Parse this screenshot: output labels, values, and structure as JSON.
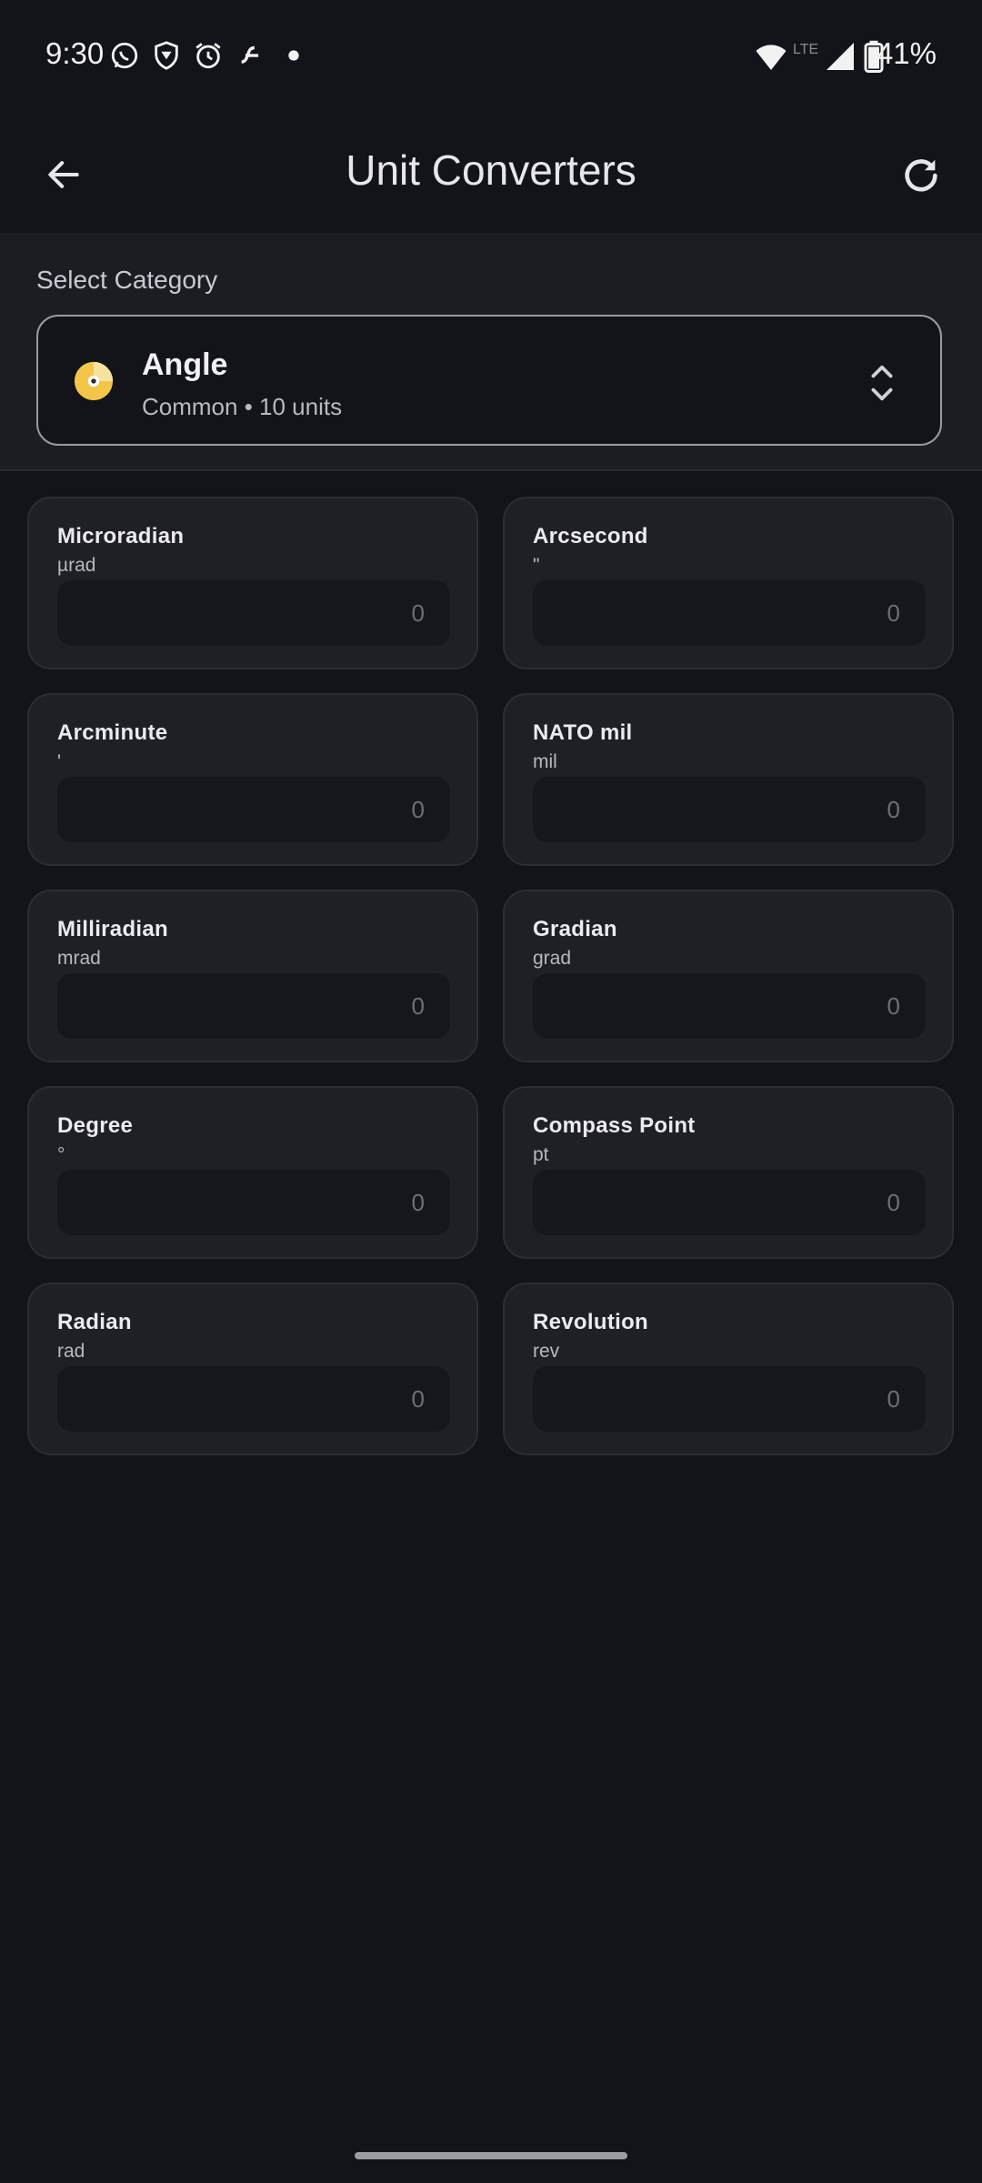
{
  "status_bar": {
    "time": "9:30",
    "battery_percent": "41%",
    "network": "LTE",
    "icons": [
      "whatsapp-icon",
      "vpn-shield-icon",
      "alarm-icon",
      "fan-icon",
      "dot-icon",
      "wifi-icon",
      "signal-icon",
      "battery-icon"
    ]
  },
  "app_bar": {
    "title": "Unit Converters",
    "back_icon": "arrow-left-icon",
    "refresh_icon": "refresh-icon"
  },
  "category": {
    "label": "Select Category",
    "name": "Angle",
    "meta": "Common • 10 units",
    "icon": "disc-icon"
  },
  "units": [
    {
      "name": "Microradian",
      "symbol": "µrad",
      "placeholder": "0"
    },
    {
      "name": "Arcsecond",
      "symbol": "\"",
      "placeholder": "0"
    },
    {
      "name": "Arcminute",
      "symbol": "'",
      "placeholder": "0"
    },
    {
      "name": "NATO mil",
      "symbol": "mil",
      "placeholder": "0"
    },
    {
      "name": "Milliradian",
      "symbol": "mrad",
      "placeholder": "0"
    },
    {
      "name": "Gradian",
      "symbol": "grad",
      "placeholder": "0"
    },
    {
      "name": "Degree",
      "symbol": "°",
      "placeholder": "0"
    },
    {
      "name": "Compass Point",
      "symbol": "pt",
      "placeholder": "0"
    },
    {
      "name": "Radian",
      "symbol": "rad",
      "placeholder": "0"
    },
    {
      "name": "Revolution",
      "symbol": "rev",
      "placeholder": "0"
    }
  ],
  "colors": {
    "background": "#131419",
    "card": "#1f2026",
    "input": "#16171c"
  }
}
